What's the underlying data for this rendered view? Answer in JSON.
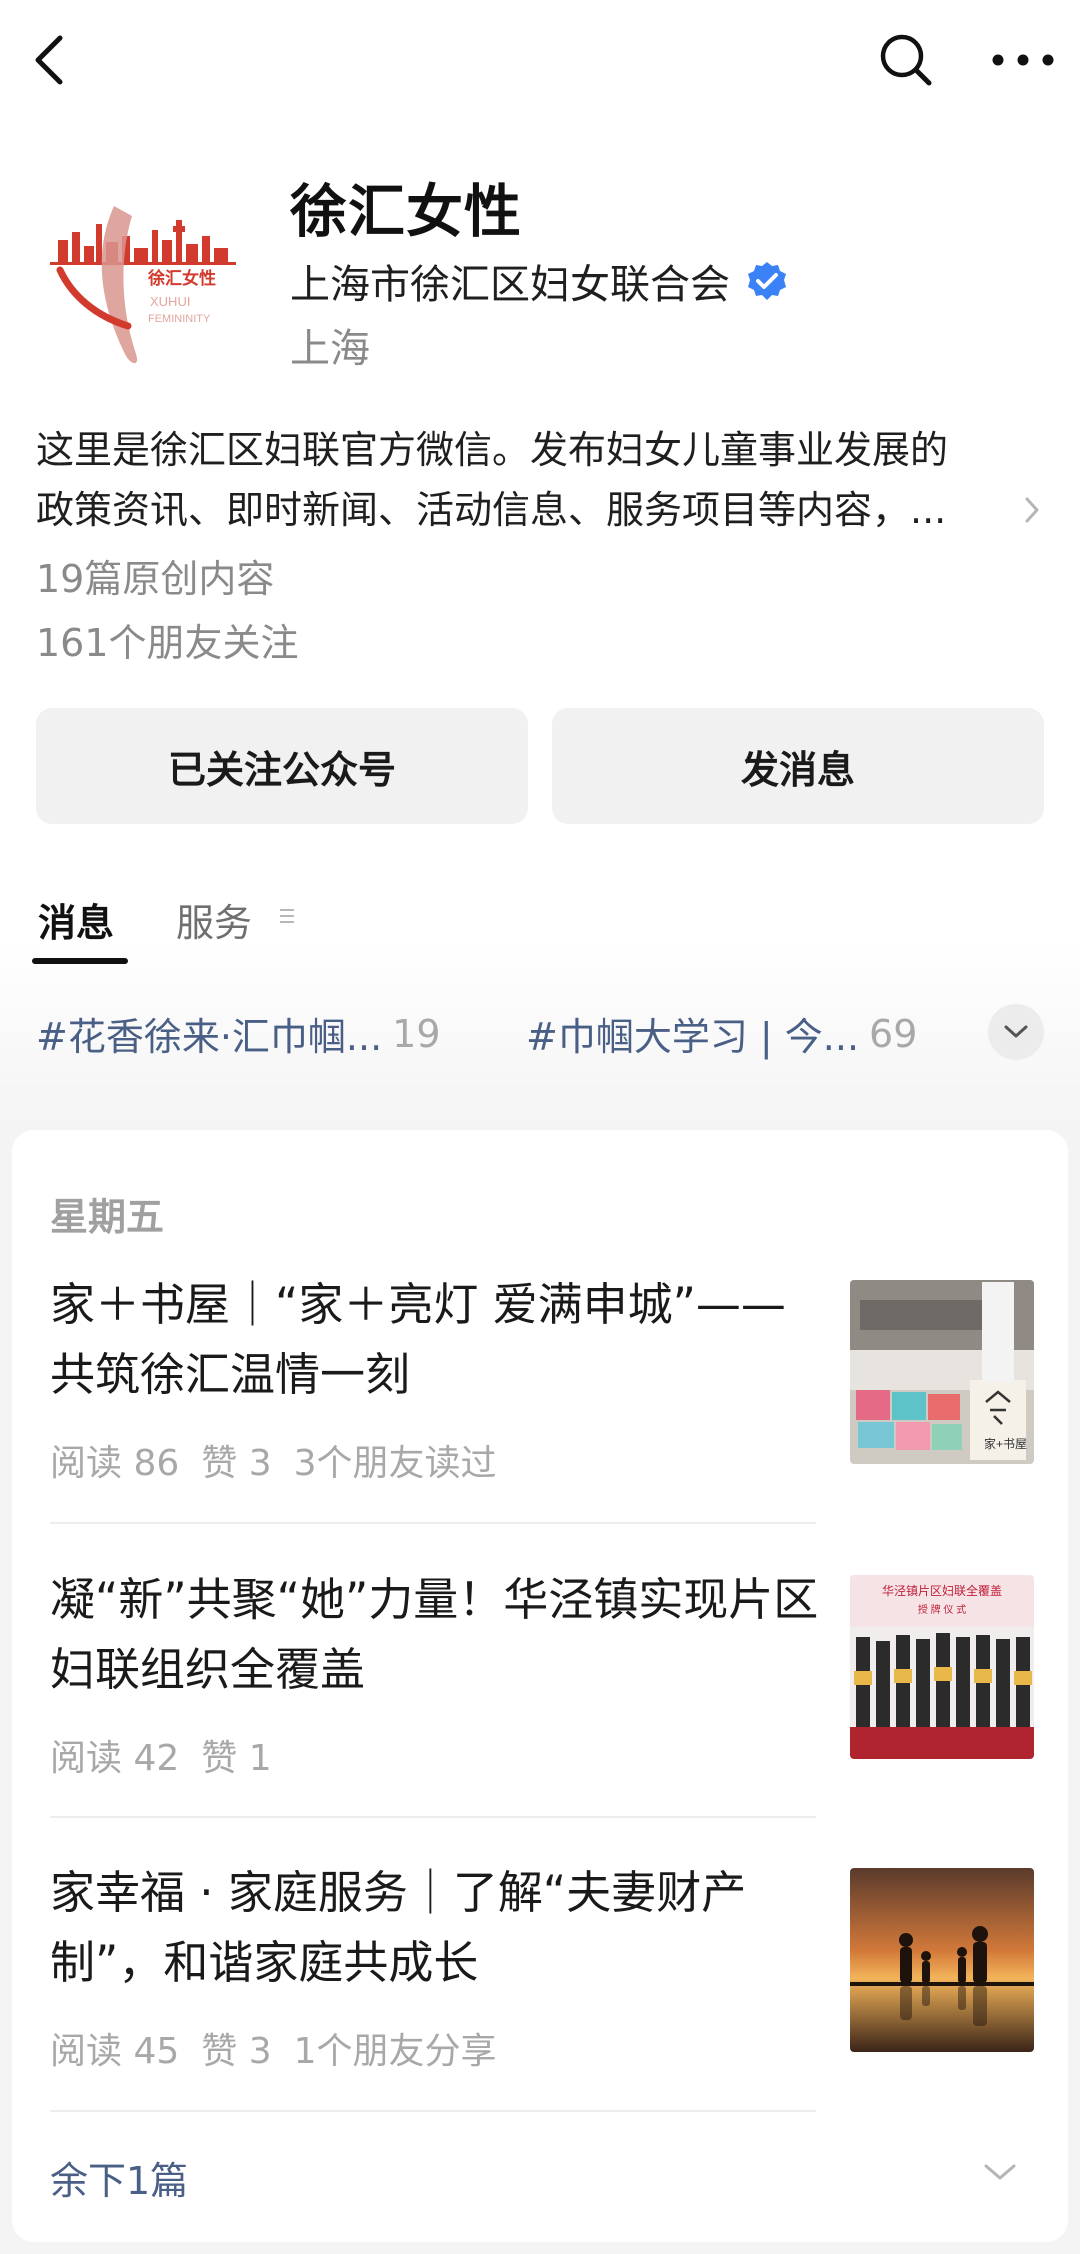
{
  "account": {
    "name": "徐汇女性",
    "org": "上海市徐汇区妇女联合会",
    "location": "上海",
    "description_line1": "这里是徐汇区妇联官方微信。发布妇女儿童事业发展的",
    "description_line2": "政策资讯、即时新闻、活动信息、服务项目等内容，...",
    "original_count": "19篇原创内容",
    "friends_following": "161个朋友关注",
    "avatar_logo_title": "徐汇女性",
    "avatar_logo_sub1": "XUHUI",
    "avatar_logo_sub2": "FEMININITY"
  },
  "buttons": {
    "follow_label": "已关注公众号",
    "message_label": "发消息"
  },
  "tabs": [
    {
      "label": "消息",
      "active": true
    },
    {
      "label": "服务",
      "active": false
    }
  ],
  "topics": [
    {
      "text": "#花香徐来·汇巾帼...",
      "count": "19"
    },
    {
      "text": "#巾帼大学习 | 今...",
      "count": "69"
    }
  ],
  "feed": {
    "day_label": "星期五",
    "articles": [
      {
        "title": "家＋书屋｜“家＋亮灯 爱满申城”——共筑徐汇温情一刻",
        "reads": "阅读 86",
        "likes": "赞 3",
        "extra": "3个朋友读过"
      },
      {
        "title": "凝“新”共聚“她”力量！华泾镇实现片区妇联组织全覆盖",
        "reads": "阅读 42",
        "likes": "赞 1",
        "extra": ""
      },
      {
        "title": "家幸福 · 家庭服务｜了解“夫妻财产制”，和谐家庭共成长",
        "reads": "阅读 45",
        "likes": "赞 3",
        "extra": "1个朋友分享"
      }
    ],
    "thumb2_banner": "华泾镇片区妇联全覆盖",
    "thumb2_sub": "授 牌 仪 式",
    "thumb1_sign": "家+书屋",
    "remaining": "余下1篇"
  },
  "colors": {
    "link": "#4a5f86",
    "verified": "#3b82f6",
    "logo_red": "#d23a2e"
  }
}
